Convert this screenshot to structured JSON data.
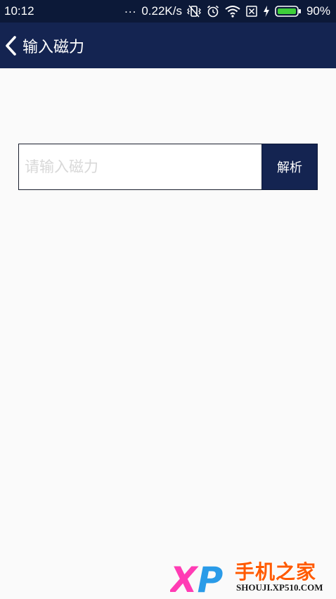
{
  "status_bar": {
    "time": "10:12",
    "dots": "...",
    "network_speed": "0.22K/s",
    "battery": "90%",
    "icons": [
      "vibrate-off-icon",
      "alarm-icon",
      "wifi-icon",
      "no-sim-icon",
      "charging-icon",
      "battery-icon"
    ]
  },
  "header": {
    "back_icon": "chevron-left-icon",
    "title": "输入磁力"
  },
  "search": {
    "placeholder": "请输入磁力",
    "value": "",
    "button_label": "解析"
  },
  "watermark": {
    "logo_text": "XP",
    "name": "手机之家",
    "url": "SHOUJI.XP510.COM"
  },
  "colors": {
    "status_bar_bg": "#0c1938",
    "app_bar_bg": "#142451",
    "page_bg": "#fafafa",
    "button_bg": "#142451",
    "placeholder": "#d8d8d8",
    "watermark_orange": "#ff5a00",
    "watermark_pink": "#ff3cb4",
    "watermark_blue": "#2a9be8"
  }
}
